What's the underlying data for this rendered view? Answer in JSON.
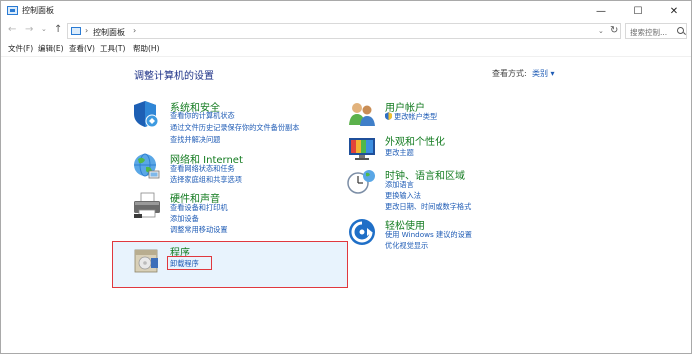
{
  "window": {
    "title": "控制面板",
    "min_glyph": "—",
    "max_glyph": "☐",
    "close_glyph": "✕"
  },
  "nav": {
    "back_glyph": "←",
    "forward_glyph": "→",
    "recent_glyph": "⌄",
    "up_glyph": "↑",
    "address_sep": "›",
    "address": "控制面板",
    "address_sep2": "›",
    "dropdown_glyph": "⌄",
    "refresh_glyph": "↻",
    "search_placeholder": "搜索控制..."
  },
  "menu": [
    "文件(F)",
    "编辑(E)",
    "查看(V)",
    "工具(T)",
    "帮助(H)"
  ],
  "main": {
    "title": "调整计算机的设置",
    "view_by_label": "查看方式:",
    "view_by_value": "类别 ▾"
  },
  "left_categories": [
    {
      "icon": "shield-icon",
      "title": "系统和安全",
      "links": [
        "查看你的计算机状态",
        "通过文件历史记录保存你的文件备份副本",
        "查找并解决问题"
      ]
    },
    {
      "icon": "network-icon",
      "title": "网络和 Internet",
      "links": [
        "查看网络状态和任务",
        "选择家庭组和共享选项"
      ]
    },
    {
      "icon": "printer-icon",
      "title": "硬件和声音",
      "links": [
        "查看设备和打印机",
        "添加设备",
        "调整常用移动设置"
      ]
    },
    {
      "icon": "programs-icon",
      "title": "程序",
      "links": [
        "卸载程序"
      ]
    }
  ],
  "right_categories": [
    {
      "icon": "users-icon",
      "title": "用户帐户",
      "links": [
        "更改帐户类型"
      ]
    },
    {
      "icon": "display-icon",
      "title": "外观和个性化",
      "links": [
        "更改主题"
      ]
    },
    {
      "icon": "clock-globe-icon",
      "title": "时钟、语言和区域",
      "links": [
        "添加语言",
        "更换输入法",
        "更改日期、时间或数字格式"
      ]
    },
    {
      "icon": "ease-of-access-icon",
      "title": "轻松使用",
      "links": [
        "使用 Windows 建议的设置",
        "优化视觉显示"
      ]
    }
  ],
  "colors": {
    "category_title": "#137b20",
    "link": "#1e5bb5",
    "heading": "#1e3287",
    "highlight_border": "#e0383e",
    "highlight_fill": "#e8f3fd"
  }
}
